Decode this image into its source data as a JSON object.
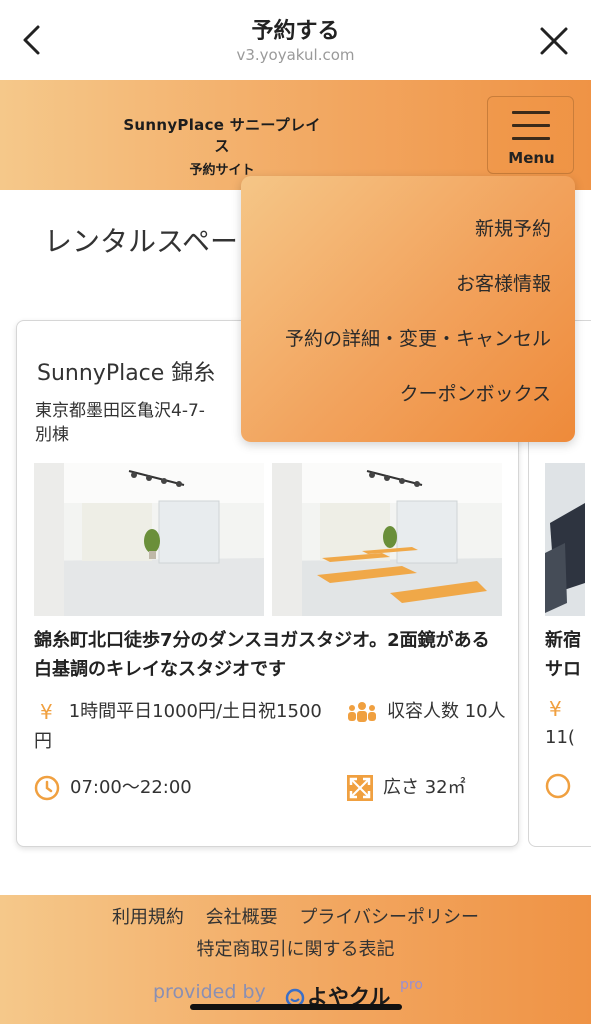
{
  "browser": {
    "title": "予約する",
    "url": "v3.yoyakul.com"
  },
  "header": {
    "brand_name": "SunnyPlace サニープレイス",
    "brand_sub": "予約サイト",
    "menu_label": "Menu"
  },
  "menu": {
    "items": [
      "新規予約",
      "お客様情報",
      "予約の詳細・変更・キャンセル",
      "クーポンボックス"
    ]
  },
  "main": {
    "heading": "レンタルスペー",
    "card": {
      "title": "SunnyPlace 錦糸",
      "address": "東京都墨田区亀沢4-7-",
      "address_line2": "別棟",
      "description": "錦糸町北口徒歩7分のダンスヨガスタジオ。2面鏡がある白基調のキレイなスタジオです",
      "price": "1時間平日1000円/土日祝1500円",
      "capacity": "収容人数 10人",
      "hours": "07:00〜22:00",
      "area": "広さ 32㎡"
    },
    "card2": {
      "desc_line1": "新宿",
      "desc_line2": "サロ",
      "price_partial": "11("
    }
  },
  "footer": {
    "links": [
      "利用規約",
      "会社概要",
      "プライバシーポリシー"
    ],
    "link_line2": "特定商取引に関する表記",
    "provided_by": "provided by",
    "logo_text": "よやクル",
    "logo_suffix": "pro"
  },
  "colors": {
    "accent": "#f2a55e",
    "icon": "#f0a040"
  }
}
